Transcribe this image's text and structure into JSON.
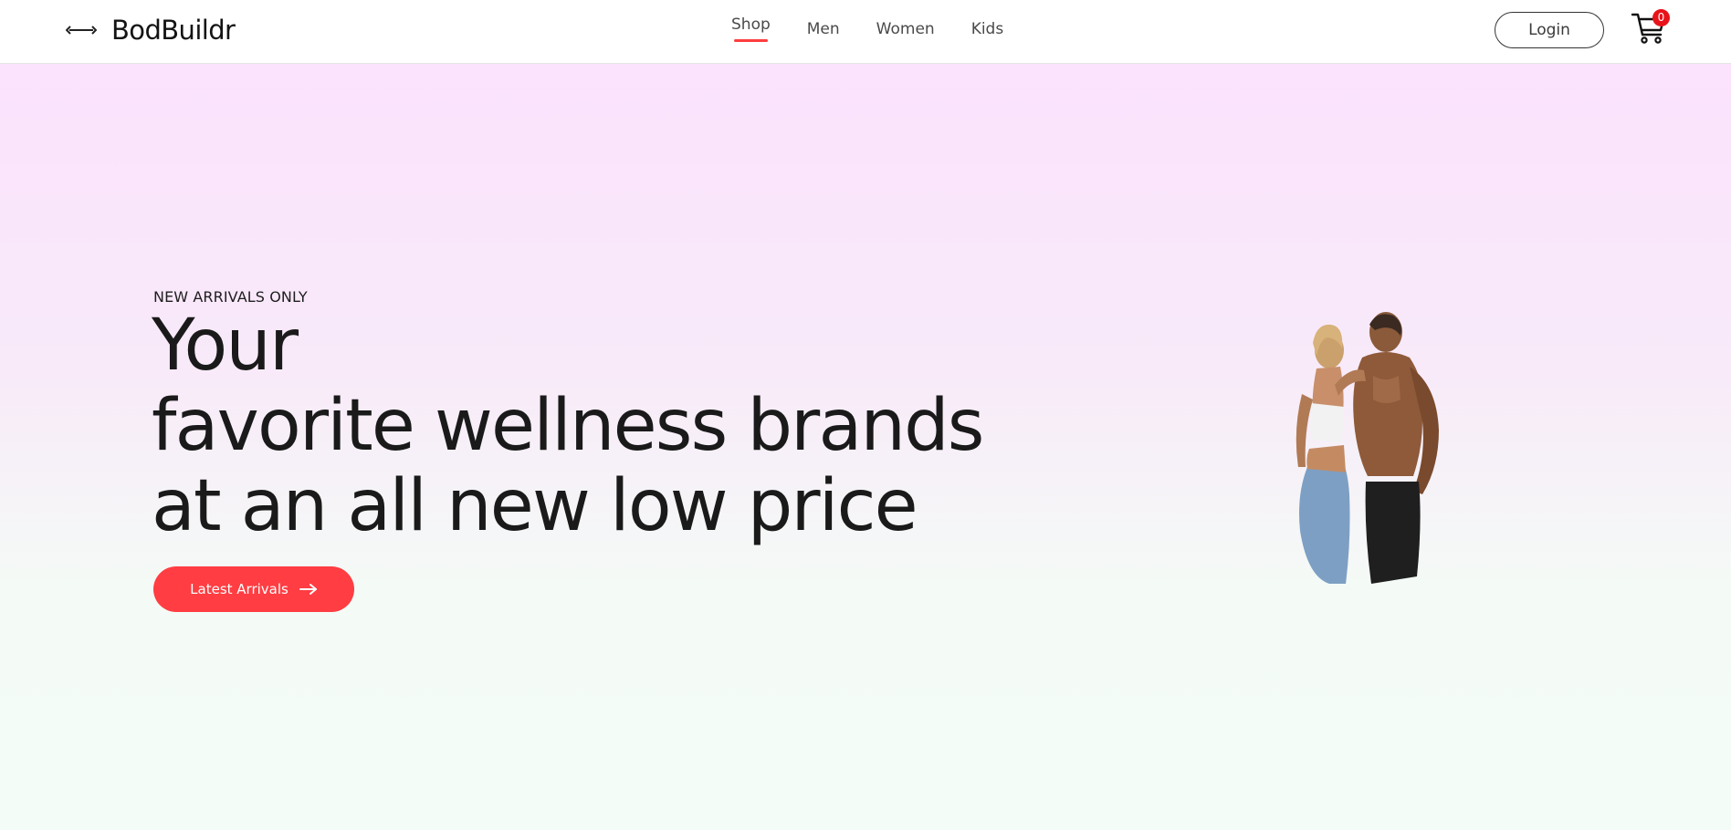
{
  "header": {
    "brand_name": "BodBuildr",
    "logo_icon": "dumbbell-icon",
    "nav": [
      {
        "label": "Shop",
        "active": true
      },
      {
        "label": "Men",
        "active": false
      },
      {
        "label": "Women",
        "active": false
      },
      {
        "label": "Kids",
        "active": false
      }
    ],
    "login_label": "Login",
    "cart_icon": "cart-icon",
    "cart_count": "0"
  },
  "hero": {
    "eyebrow": "NEW ARRIVALS ONLY",
    "headline_lines": [
      "Your",
      "favorite wellness brands",
      "at an all new low price"
    ],
    "cta_label": "Latest Arrivals",
    "cta_icon": "arrow-right-icon",
    "image": "fitness-couple-image"
  },
  "colors": {
    "accent": "#ff3d42",
    "badge": "#e8131a",
    "hero_gradient_top": "#fbe2fd",
    "hero_gradient_bottom": "#f4fcf8"
  }
}
